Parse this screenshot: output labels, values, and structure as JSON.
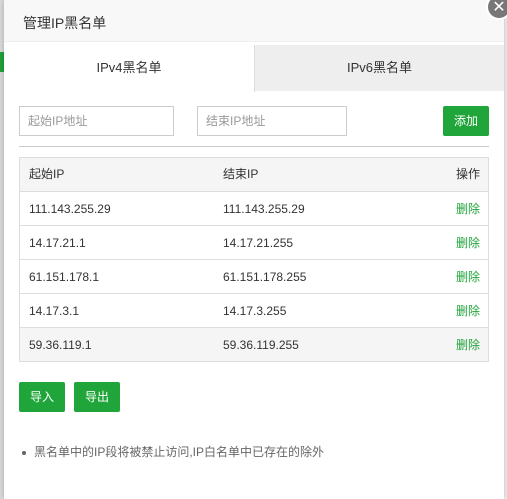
{
  "dialog": {
    "title": "管理IP黑名单",
    "close_icon": "close-icon"
  },
  "tabs": [
    {
      "label": "IPv4黑名单",
      "active": true
    },
    {
      "label": "IPv6黑名单",
      "active": false
    }
  ],
  "form": {
    "start_placeholder": "起始IP地址",
    "end_placeholder": "结束IP地址",
    "add_label": "添加"
  },
  "table": {
    "headers": [
      "起始IP",
      "结束IP",
      "操作"
    ],
    "rows": [
      {
        "start": "111.143.255.29",
        "end": "111.143.255.29",
        "action": "删除"
      },
      {
        "start": "14.17.21.1",
        "end": "14.17.21.255",
        "action": "删除"
      },
      {
        "start": "61.151.178.1",
        "end": "61.151.178.255",
        "action": "删除"
      },
      {
        "start": "14.17.3.1",
        "end": "14.17.3.255",
        "action": "删除"
      },
      {
        "start": "59.36.119.1",
        "end": "59.36.119.255",
        "action": "删除"
      }
    ]
  },
  "footer": {
    "import_label": "导入",
    "export_label": "导出"
  },
  "note": "黑名单中的IP段将被禁止访问,IP白名单中已存在的除外",
  "colors": {
    "accent": "#20a53a"
  }
}
